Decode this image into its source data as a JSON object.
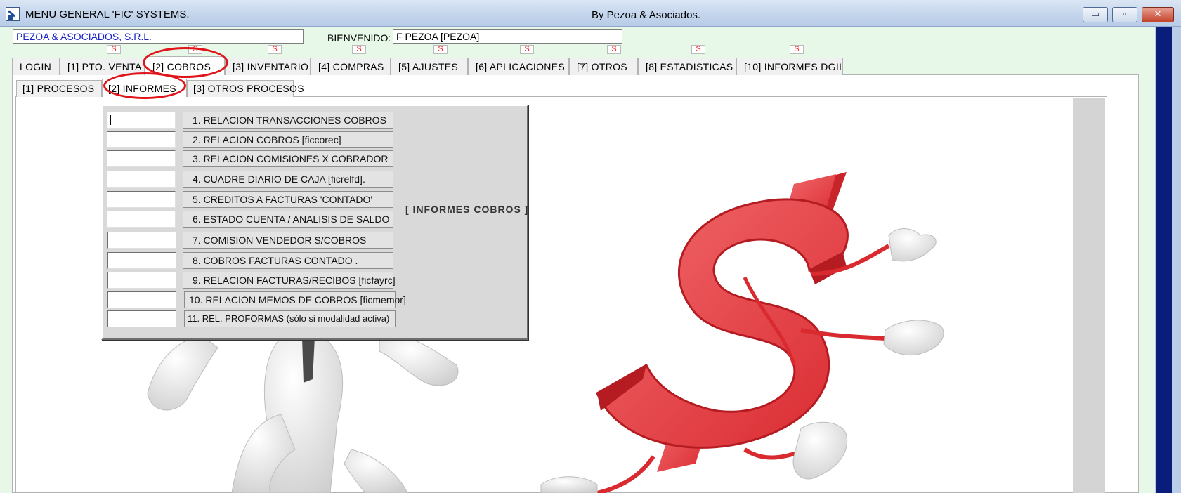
{
  "window": {
    "title": "MENU GENERAL 'FIC' SYSTEMS.",
    "center_title": "By Pezoa & Asociados.",
    "minimize": "▭",
    "maximize": "▫",
    "close": "✕"
  },
  "header": {
    "company": "PEZOA & ASOCIADOS, S.R.L.",
    "welcome_label": "BIENVENIDO:",
    "user": "F PEZOA [PEZOA]",
    "s_mark": "S"
  },
  "main_tabs": [
    {
      "label": "LOGIN"
    },
    {
      "label": "[1] PTO. VENTA"
    },
    {
      "label": "[2]  COBROS"
    },
    {
      "label": "[3] INVENTARIO"
    },
    {
      "label": "[4] COMPRAS"
    },
    {
      "label": "[5] AJUSTES"
    },
    {
      "label": "[6] APLICACIONES"
    },
    {
      "label": "[7] OTROS"
    },
    {
      "label": "[8] ESTADISTICAS"
    },
    {
      "label": "[10] INFORMES DGII"
    }
  ],
  "sub_tabs": [
    {
      "label": "[1] PROCESOS"
    },
    {
      "label": "[2] INFORMES"
    },
    {
      "label": "[3] OTROS PROCESOS"
    }
  ],
  "menu": {
    "title": "[ INFORMES COBROS ]",
    "items": [
      {
        "label": "1. RELACION TRANSACCIONES COBROS",
        "code": ""
      },
      {
        "label": "2. RELACION COBROS [ficcorec]",
        "code": ""
      },
      {
        "label": "3. RELACION COMISIONES X COBRADOR",
        "code": ""
      },
      {
        "label": "4. CUADRE DIARIO DE CAJA [ficrelfd].",
        "code": ""
      },
      {
        "label": "5. CREDITOS A FACTURAS 'CONTADO'",
        "code": ""
      },
      {
        "label": "6. ESTADO CUENTA / ANALISIS DE SALDO",
        "code": ""
      },
      {
        "label": "7. COMISION VENDEDOR S/COBROS",
        "code": ""
      },
      {
        "label": "8. COBROS FACTURAS CONTADO            .",
        "code": ""
      },
      {
        "label": "9. RELACION FACTURAS/RECIBOS [ficfayrc]",
        "code": ""
      },
      {
        "label": "10. RELACION MEMOS DE COBROS [ficmemor]",
        "code": ""
      },
      {
        "label": "11. REL. PROFORMAS (sólo si modalidad activa)",
        "code": ""
      }
    ]
  },
  "colors": {
    "annotation_ring": "#e0151b",
    "dollar_red": "#e8383c",
    "company_text": "#1a23c8"
  },
  "icons": {
    "app": "app-icon",
    "illustration": "running-dollar-illustration"
  }
}
